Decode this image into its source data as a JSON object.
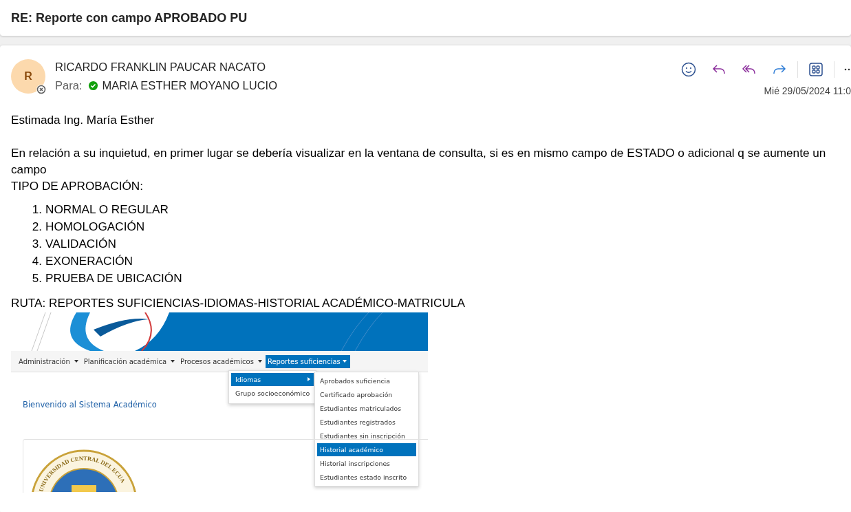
{
  "subject": "RE: Reporte con campo APROBADO PU",
  "message": {
    "initial": "R",
    "sender": "RICARDO FRANKLIN PAUCAR NACATO",
    "to_label": "Para:",
    "recipient": "MARIA ESTHER MOYANO LUCIO",
    "date": "Mié 29/05/2024 11:0"
  },
  "body": {
    "greeting": "Estimada Ing. María Esther",
    "paragraph": "En relación a su inquietud, en primer lugar se debería visualizar en la ventana de consulta, si es en mismo campo de ESTADO o adicional q se aumente un campo",
    "heading": "TIPO DE APROBACIÓN:",
    "list": [
      {
        "number": "1.",
        "text": "NORMAL O REGULAR"
      },
      {
        "number": "2.",
        "text": "HOMOLOGACIÓN"
      },
      {
        "number": "3.",
        "text": "VALIDACIÓN"
      },
      {
        "number": "4.",
        "text": "EXONERACIÓN"
      },
      {
        "number": "5.",
        "text": "PRUEBA DE UBICACIÓN"
      }
    ],
    "route": "RUTA: REPORTES SUFICIENCIAS-IDIOMAS-HISTORIAL ACADÉMICO-MATRICULA"
  },
  "embedded": {
    "nav": [
      {
        "label": "Administración",
        "selected": false
      },
      {
        "label": "Planificación académica",
        "selected": false
      },
      {
        "label": "Procesos académicos",
        "selected": false
      },
      {
        "label": "Reportes suficiencias",
        "selected": true
      }
    ],
    "dropdown": [
      {
        "label": "Idiomas",
        "selected": true,
        "submenu": true
      },
      {
        "label": "Grupo socioeconómico",
        "selected": false,
        "submenu": false
      }
    ],
    "submenu": [
      {
        "label": "Aprobados suficiencia",
        "selected": false
      },
      {
        "label": "Certificado aprobación",
        "selected": false
      },
      {
        "label": "Estudiantes matriculados",
        "selected": false
      },
      {
        "label": "Estudiantes registrados",
        "selected": false
      },
      {
        "label": "Estudiantes sin inscripción",
        "selected": false
      },
      {
        "label": "Historial académico",
        "selected": true
      },
      {
        "label": "Historial inscripciones",
        "selected": false
      },
      {
        "label": "Estudiantes estado inscrito",
        "selected": false
      }
    ],
    "welcome": "Bienvenido al Sistema Académico",
    "seal_text": "UNIVERSIDAD CENTRAL DEL ECUA"
  }
}
